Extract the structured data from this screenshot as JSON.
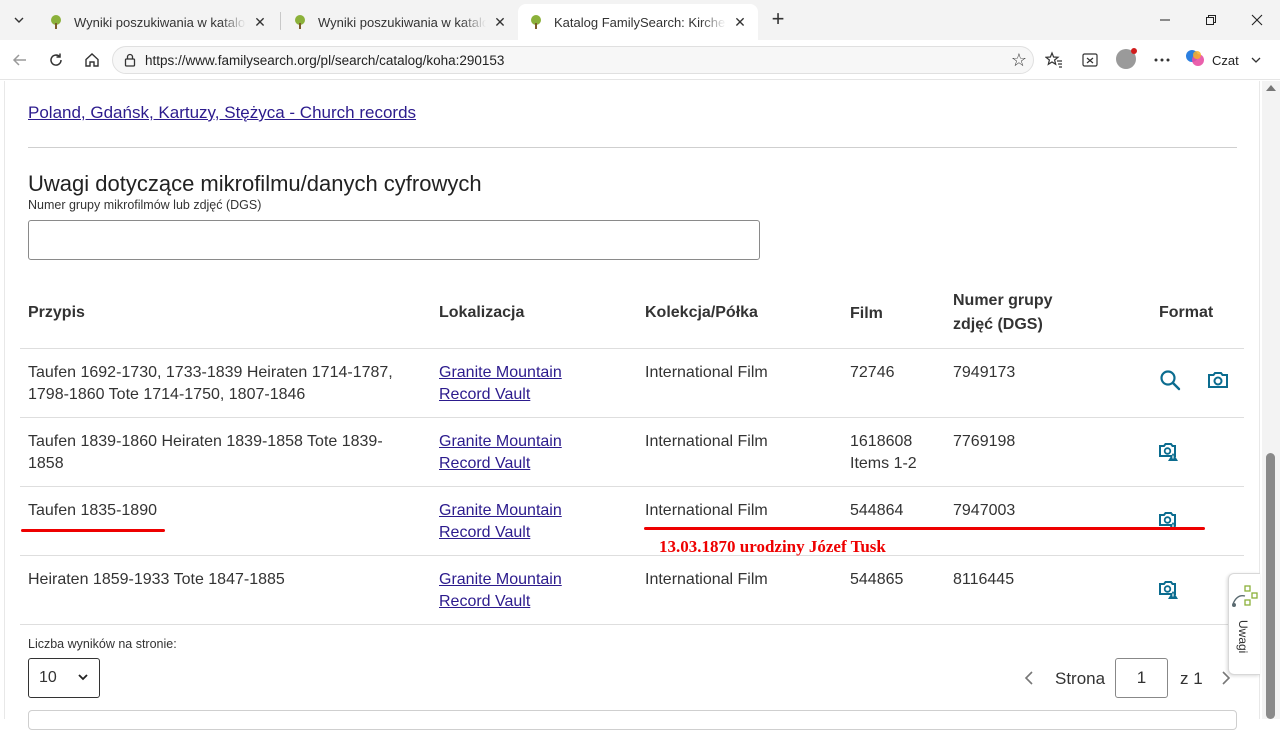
{
  "browser": {
    "tabs": [
      {
        "title": "Wyniki poszukiwania w katalogu d",
        "active": false
      },
      {
        "title": "Wyniki poszukiwania w katalogu d",
        "active": false
      },
      {
        "title": "Katalog FamilySearch: Kirchenbuch",
        "active": true
      }
    ],
    "url": "https://www.familysearch.org/pl/search/catalog/koha:290153",
    "copilot_label": "Czat"
  },
  "page": {
    "breadcrumb_link": "Poland, Gdańsk, Kartuzy, Stężyca - Church records",
    "section_title": "Uwagi dotyczące mikrofilmu/danych cyfrowych",
    "dgs_field_label": "Numer grupy mikrofilmów lub zdjęć (DGS)",
    "dgs_field_value": "",
    "table": {
      "headers": {
        "note": "Przypis",
        "location": "Lokalizacja",
        "collection": "Kolekcja/Półka",
        "film": "Film",
        "dgs_line1": "Numer grupy",
        "dgs_line2": "zdjęć (DGS)",
        "format": "Format"
      },
      "rows": [
        {
          "note_line1": "Taufen 1692-1730, 1733-1839 Heiraten 1714-1787,",
          "note_line2": "1798-1860 Tote 1714-1750, 1807-1846",
          "location_line1": "Granite Mountain",
          "location_line2": "Record Vault",
          "collection": "International Film",
          "film_line1": "72746",
          "film_line2": "",
          "dgs": "7949173",
          "formats": [
            "search-icon",
            "camera-icon"
          ]
        },
        {
          "note_line1": "Taufen 1839-1860 Heiraten 1839-1858 Tote 1839-",
          "note_line2": "1858",
          "location_line1": "Granite Mountain",
          "location_line2": "Record Vault",
          "collection": "International Film",
          "film_line1": "1618608",
          "film_line2": "Items 1-2",
          "dgs": "7769198",
          "formats": [
            "camera-restricted-icon"
          ]
        },
        {
          "note_line1": "Taufen 1835-1890",
          "note_line2": "",
          "location_line1": "Granite Mountain",
          "location_line2": "Record Vault",
          "collection": "International Film",
          "film_line1": "544864",
          "film_line2": "",
          "dgs": "7947003",
          "formats": [
            "camera-restricted-icon"
          ]
        },
        {
          "note_line1": "Heiraten 1859-1933 Tote 1847-1885",
          "note_line2": "",
          "location_line1": "Granite Mountain",
          "location_line2": "Record Vault",
          "collection": "International Film",
          "film_line1": "544865",
          "film_line2": "",
          "dgs": "8116445",
          "formats": [
            "camera-restricted-icon"
          ]
        }
      ]
    },
    "annotation_text": "13.03.1870 urodziny Józef Tusk",
    "annotation_color": "#e00000",
    "per_page_label": "Liczba wyników na stronie:",
    "per_page_value": "10",
    "pager": {
      "page_label": "Strona",
      "page_value": "1",
      "of_label": "z 1"
    },
    "feedback_label": "Uwagi",
    "link_color": "#2c1b8d",
    "icon_color": "#0b6c8f"
  }
}
